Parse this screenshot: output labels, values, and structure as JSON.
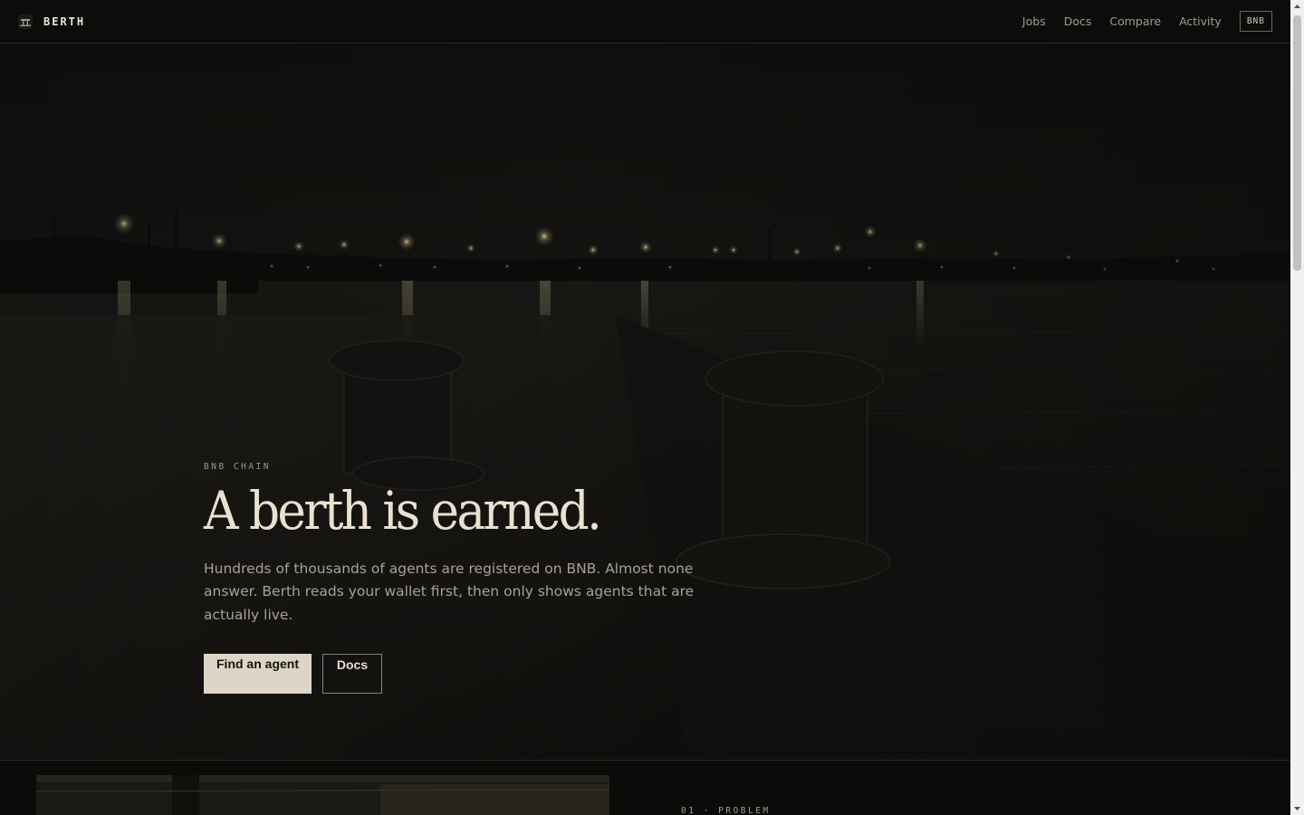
{
  "header": {
    "brand": "BERTH",
    "nav": [
      "Jobs",
      "Docs",
      "Compare",
      "Activity"
    ],
    "chain_badge": "BNB"
  },
  "hero": {
    "eyebrow": "BNB CHAIN",
    "headline": "A berth is earned.",
    "lede": "Hundreds of thousands of agents are registered on BNB. Almost none answer. Berth reads your wallet first, then only shows agents that are actually live.",
    "primary_cta": "Find an agent",
    "secondary_cta": "Docs"
  },
  "next_section": {
    "label": "01 · PROBLEM"
  },
  "colors": {
    "background": "#0b0b0a",
    "text": "#e9e1cf",
    "muted": "#a8a295",
    "primary_button": "#ddd6c6"
  },
  "icons": {
    "brand": "bollard-icon"
  }
}
